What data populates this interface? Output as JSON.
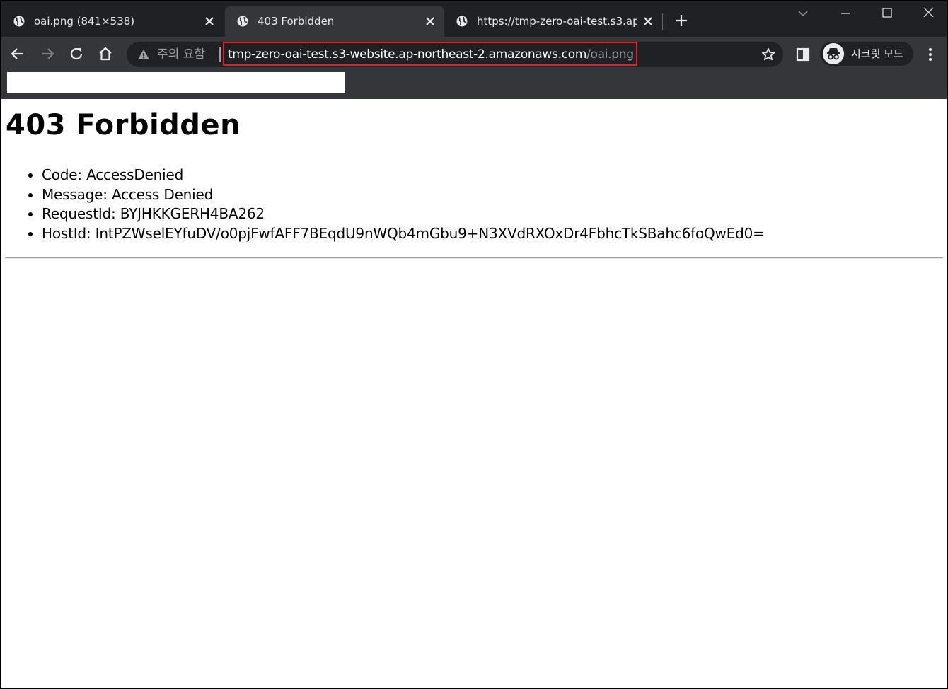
{
  "browser": {
    "tabs": [
      {
        "title": "oai.png (841×538)",
        "active": false
      },
      {
        "title": "403 Forbidden",
        "active": true
      },
      {
        "title": "https://tmp-zero-oai-test.s3.ap-r",
        "active": false
      }
    ],
    "icons": {
      "tab_favicon": "globe-icon",
      "tab_close": "close-icon",
      "new_tab": "plus-icon",
      "tab_search": "chevron-down-icon",
      "minimize": "minimize-icon",
      "maximize": "maximize-icon",
      "window_close": "close-icon",
      "back": "arrow-left-icon",
      "forward": "arrow-right-icon",
      "reload": "reload-icon",
      "home": "home-icon",
      "security": "warning-icon",
      "bookmark": "star-icon",
      "side_panel": "side-panel-icon",
      "incognito": "incognito-icon",
      "menu": "kebab-menu-icon"
    },
    "address_bar": {
      "security_label": "주의 요함",
      "url_host": "tmp-zero-oai-test.s3-website.ap-northeast-2.amazonaws.com",
      "url_path": "/oai.png"
    },
    "profile": {
      "label": "시크릿 모드"
    },
    "colors": {
      "tabstrip_bg": "#202124",
      "toolbar_bg": "#35363a",
      "highlight_border": "#e2202a"
    }
  },
  "page": {
    "heading": "403 Forbidden",
    "details": [
      "Code: AccessDenied",
      "Message: Access Denied",
      "RequestId: BYJHKKGERH4BA262",
      "HostId: IntPZWselEYfuDV/o0pjFwfAFF7BEqdU9nWQb4mGbu9+N3XVdRXOxDr4FbhcTkSBahc6foQwEd0="
    ]
  }
}
